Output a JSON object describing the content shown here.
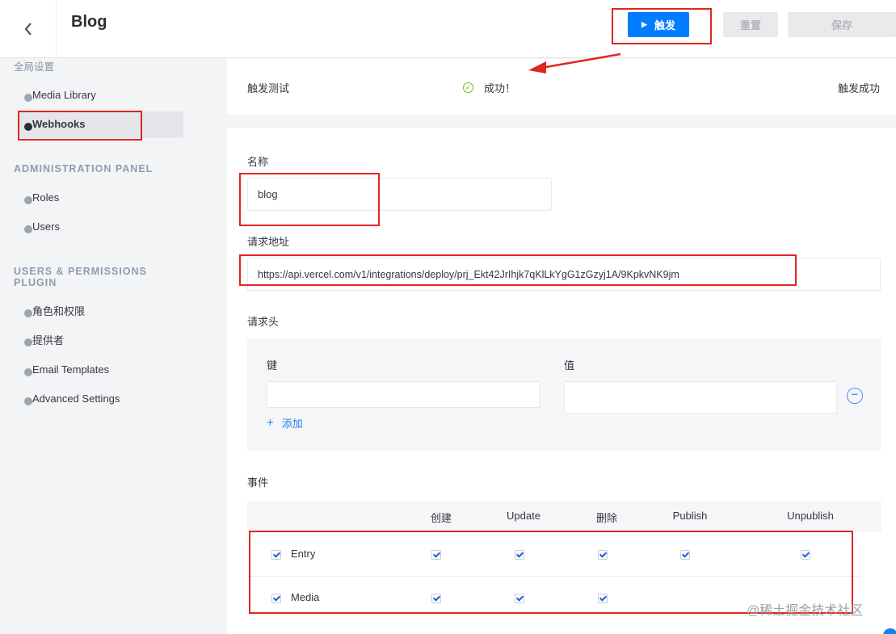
{
  "header": {
    "title": "Blog",
    "trigger_label": "触发",
    "reset_label": "重置",
    "save_label": "保存"
  },
  "sidebar": {
    "global_title": "全局设置",
    "global_items": [
      "Media Library",
      "Webhooks"
    ],
    "admin_title": "ADMINISTRATION PANEL",
    "admin_items": [
      "Roles",
      "Users"
    ],
    "users_title_1": "USERS & PERMISSIONS",
    "users_title_2": "PLUGIN",
    "users_items": [
      "角色和权限",
      "提供者",
      "Email Templates",
      "Advanced Settings"
    ],
    "active_item": "Webhooks"
  },
  "status": {
    "label": "触发测试",
    "message": "成功！",
    "result": "触发成功",
    "color": "#6dbb1a"
  },
  "form": {
    "name_label": "名称",
    "name_value": "blog",
    "url_label": "请求地址",
    "url_value": "https://api.vercel.com/v1/integrations/deploy/prj_Ekt42JrIhjk7qKlLkYgG1zGzyj1A/9KpkvNK9jm",
    "headers_label": "请求头",
    "key_label": "键",
    "value_label": "值",
    "add_label": "添加",
    "events_label": "事件"
  },
  "events": {
    "columns": [
      "创建",
      "Update",
      "删除",
      "Publish",
      "Unpublish"
    ],
    "rows": [
      {
        "name": "Entry",
        "checked": [
          true,
          true,
          true,
          true,
          true
        ]
      },
      {
        "name": "Media",
        "checked": [
          true,
          true,
          true,
          false,
          false
        ]
      }
    ]
  },
  "watermark": "@稀土掘金技术社区",
  "colors": {
    "accent": "#007eff",
    "annotation": "#e0261f"
  }
}
